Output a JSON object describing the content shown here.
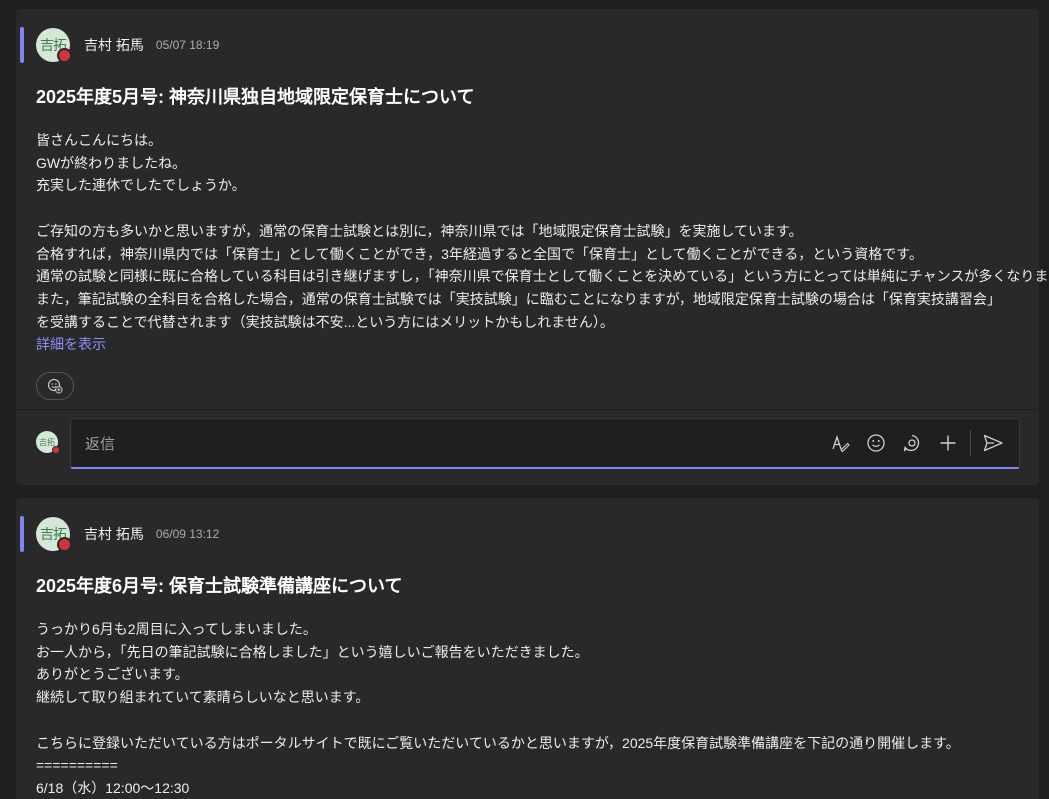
{
  "posts": [
    {
      "avatar_initials": "吉拓",
      "author": "吉村 拓馬",
      "timestamp": "05/07 18:19",
      "subject": "2025年度5月号: 神奈川県独自地域限定保育士について",
      "lines": [
        "皆さんこんにちは。",
        "GWが終わりましたね。",
        "充実した連休でしたでしょうか。",
        "",
        "ご存知の方も多いかと思いますが，通常の保育士試験とは別に，神奈川県では「地域限定保育士試験」を実施しています。",
        "合格すれば，神奈川県内では「保育士」として働くことができ，3年経過すると全国で「保育士」として働くことができる，という資格です。",
        "通常の試験と同様に既に合格している科目は引き継げますし，「神奈川県で保育士として働くことを決めている」という方にとっては単純にチャンスが多くなります。",
        "また，筆記試験の全科目を合格した場合，通常の保育士試験では「実技試験」に臨むことになりますが，地域限定保育士試験の場合は「保育実技講習会」",
        "を受講することで代替されます（実技試験は不安...という方にはメリットかもしれません）。"
      ],
      "show_more": "詳細を表示",
      "reply_placeholder": "返信",
      "reply_avatar_initials": "吉拓"
    },
    {
      "avatar_initials": "吉拓",
      "author": "吉村 拓馬",
      "timestamp": "06/09 13:12",
      "subject": "2025年度6月号: 保育士試験準備講座について",
      "lines": [
        "うっかり6月も2周目に入ってしまいました。",
        "お一人から，「先日の筆記試験に合格しました」という嬉しいご報告をいただきました。",
        "ありがとうございます。",
        "継続して取り組まれていて素晴らしいなと思います。",
        "",
        "こちらに登録いただいている方はポータルサイトで既にご覧いただいているかと思いますが，2025年度保育試験準備講座を下記の通り開催します。",
        "==========",
        "6/18（水）12:00〜12:30"
      ]
    }
  ],
  "icons": {
    "reaction": "add-reaction-icon",
    "format": "format-icon",
    "emoji": "emoji-icon",
    "loop": "loop-icon",
    "attach": "plus-icon",
    "send": "send-icon"
  },
  "colors": {
    "accent": "#7f85f5",
    "presence_busy": "#d13438",
    "link": "#8c91f7"
  }
}
